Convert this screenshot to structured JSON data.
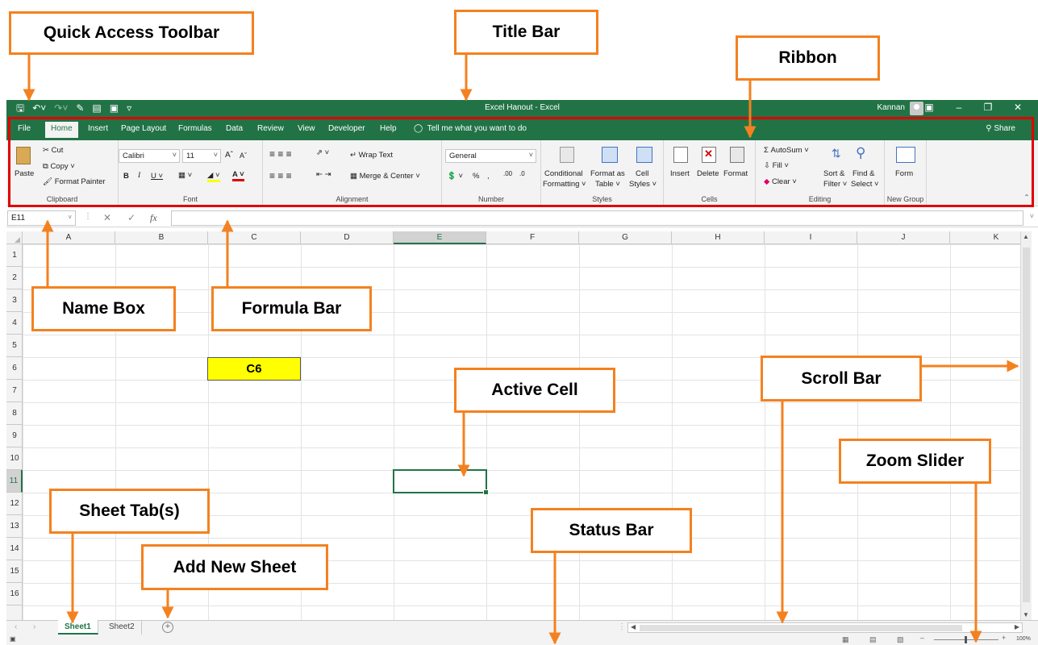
{
  "window": {
    "title": "Excel Hanout  -  Excel",
    "user": "Kannan"
  },
  "ribbon": {
    "tabs": [
      "File",
      "Home",
      "Insert",
      "Page Layout",
      "Formulas",
      "Data",
      "Review",
      "View",
      "Developer",
      "Help"
    ],
    "active_tab": "Home",
    "tell_me": "Tell me what you want to do",
    "share": "Share",
    "clipboard": {
      "paste": "Paste",
      "cut": "Cut",
      "copy": "Copy",
      "format_painter": "Format Painter",
      "label": "Clipboard"
    },
    "font": {
      "name": "Calibri",
      "size": "11",
      "label": "Font"
    },
    "alignment": {
      "wrap_text": "Wrap Text",
      "merge_center": "Merge & Center",
      "label": "Alignment"
    },
    "number": {
      "format": "General",
      "label": "Number"
    },
    "styles": {
      "conditional_1": "Conditional",
      "conditional_2": "Formatting",
      "format_table_1": "Format as",
      "format_table_2": "Table",
      "cell_styles_1": "Cell",
      "cell_styles_2": "Styles",
      "label": "Styles"
    },
    "cells": {
      "insert": "Insert",
      "delete": "Delete",
      "format": "Format",
      "label": "Cells"
    },
    "editing": {
      "autosum": "AutoSum",
      "fill": "Fill",
      "clear": "Clear",
      "sort_1": "Sort &",
      "sort_2": "Filter",
      "find_1": "Find &",
      "find_2": "Select",
      "label": "Editing"
    },
    "new_group": {
      "form": "Form",
      "label": "New Group"
    }
  },
  "formula_bar": {
    "name_box": "E11",
    "fx": "fx",
    "value": ""
  },
  "grid": {
    "columns": [
      "A",
      "B",
      "C",
      "D",
      "E",
      "F",
      "G",
      "H",
      "I",
      "J",
      "K"
    ],
    "rows": [
      "1",
      "2",
      "3",
      "4",
      "5",
      "6",
      "7",
      "8",
      "9",
      "10",
      "11",
      "12",
      "13",
      "14",
      "15",
      "16"
    ],
    "selected_column": "E",
    "selected_row": "11",
    "highlight_cell_text": "C6",
    "highlight_cell_color": "#ffff00"
  },
  "sheets": {
    "tabs": [
      "Sheet1",
      "Sheet2"
    ],
    "active": "Sheet1"
  },
  "status_bar": {
    "zoom": "100%"
  },
  "annotations": {
    "quick_access_toolbar": "Quick Access Toolbar",
    "title_bar": "Title Bar",
    "ribbon": "Ribbon",
    "name_box": "Name Box",
    "formula_bar": "Formula Bar",
    "active_cell": "Active Cell",
    "scroll_bar": "Scroll Bar",
    "zoom_slider": "Zoom Slider",
    "sheet_tabs": "Sheet Tab(s)",
    "add_new_sheet": "Add New Sheet",
    "status_bar": "Status Bar"
  },
  "colors": {
    "excel_green": "#217346",
    "callout_orange": "#f4811f",
    "ribbon_highlight_red": "#e10000"
  },
  "icons": [
    "save-icon",
    "undo-icon",
    "redo-icon",
    "user-avatar-icon",
    "ribbon-display-icon",
    "minimize-icon",
    "restore-icon",
    "close-icon",
    "lightbulb-icon",
    "share-icon",
    "add-sheet-icon",
    "zoom-slider-icon"
  ]
}
